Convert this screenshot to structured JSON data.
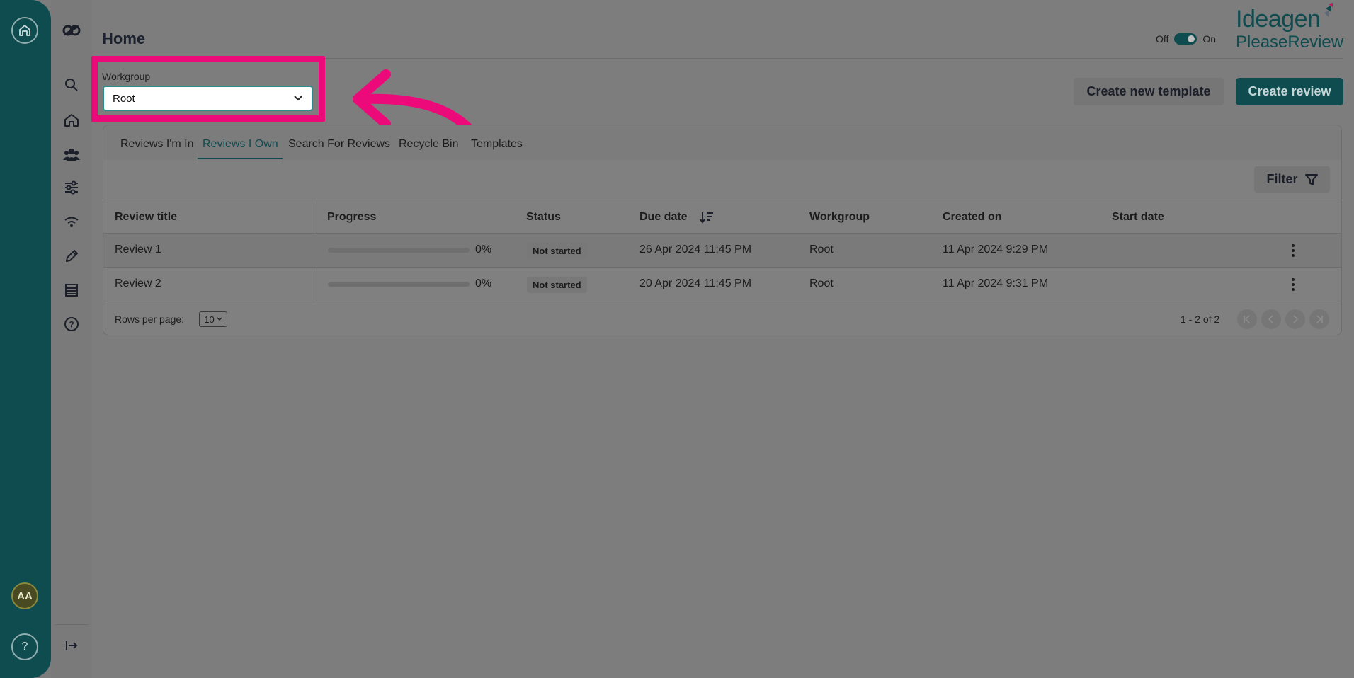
{
  "colors": {
    "rail": "#0e4c4f",
    "accent": "#0e4c4f",
    "highlight": "#ec0a7a",
    "backdrop": "#7d7d7d"
  },
  "rail": {
    "home_icon": "home-circle-icon",
    "avatar_initials": "AA",
    "help_glyph": "?"
  },
  "nav": {
    "items": [
      {
        "icon": "search-icon"
      },
      {
        "icon": "home-icon"
      },
      {
        "icon": "users-icon"
      },
      {
        "icon": "sliders-icon"
      },
      {
        "icon": "wifi-icon"
      },
      {
        "icon": "pencil-icon"
      },
      {
        "icon": "list-icon"
      },
      {
        "icon": "help-icon"
      }
    ],
    "collapse_icon": "expand-right-icon"
  },
  "header": {
    "title": "Home",
    "toggle_off": "Off",
    "toggle_on": "On",
    "brand_main": "Ideagen",
    "brand_sub": "PleaseReview"
  },
  "workgroup": {
    "label": "Workgroup",
    "value": "Root"
  },
  "actions": {
    "create_template": "Create new template",
    "create_review": "Create review"
  },
  "tabs": [
    {
      "label": "Reviews I'm In"
    },
    {
      "label": "Reviews I Own"
    },
    {
      "label": "Search For Reviews"
    },
    {
      "label": "Recycle Bin"
    },
    {
      "label": "Templates"
    }
  ],
  "filter_label": "Filter",
  "table": {
    "headers": [
      "Review title",
      "Progress",
      "Status",
      "Due date",
      "Workgroup",
      "Created on",
      "Start date"
    ],
    "rows": [
      {
        "title": "Review 1",
        "progress": 0,
        "progress_label": "0%",
        "status": "Not started",
        "due": "26 Apr 2024 11:45 PM",
        "workgroup": "Root",
        "created": "11 Apr 2024 9:29 PM",
        "start": ""
      },
      {
        "title": "Review 2",
        "progress": 0,
        "progress_label": "0%",
        "status": "Not started",
        "due": "20 Apr 2024 11:45 PM",
        "workgroup": "Root",
        "created": "11 Apr 2024 9:31 PM",
        "start": ""
      }
    ]
  },
  "pagination": {
    "rows_per_page_label": "Rows per page:",
    "rows_per_page": "10",
    "range": "1 - 2 of 2"
  }
}
